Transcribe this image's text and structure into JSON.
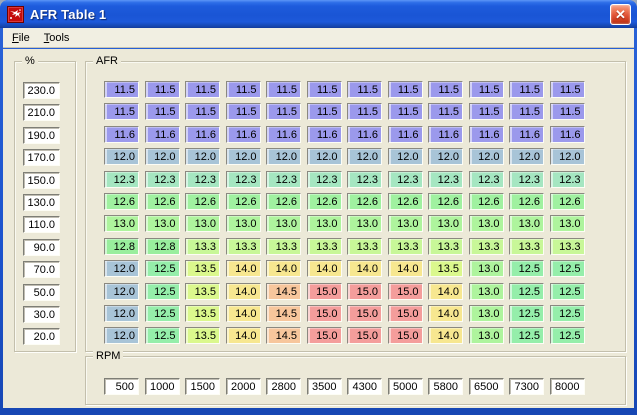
{
  "window": {
    "title": "AFR Table 1"
  },
  "titlebar": {
    "close_glyph": "✕"
  },
  "menu": {
    "items": [
      {
        "label": "File",
        "underline_index": 0
      },
      {
        "label": "Tools",
        "underline_index": 0
      }
    ]
  },
  "load_axis": {
    "label": "%",
    "values": [
      "230.0",
      "210.0",
      "190.0",
      "170.0",
      "150.0",
      "130.0",
      "110.0",
      "90.0",
      "70.0",
      "50.0",
      "30.0",
      "20.0"
    ]
  },
  "rpm_axis": {
    "label": "RPM",
    "values": [
      "500",
      "1000",
      "1500",
      "2000",
      "2800",
      "3500",
      "4300",
      "5000",
      "5800",
      "6500",
      "7300",
      "8000"
    ]
  },
  "afr_table": {
    "label": "AFR",
    "rows": [
      [
        "11.5",
        "11.5",
        "11.5",
        "11.5",
        "11.5",
        "11.5",
        "11.5",
        "11.5",
        "11.5",
        "11.5",
        "11.5",
        "11.5"
      ],
      [
        "11.5",
        "11.5",
        "11.5",
        "11.5",
        "11.5",
        "11.5",
        "11.5",
        "11.5",
        "11.5",
        "11.5",
        "11.5",
        "11.5"
      ],
      [
        "11.6",
        "11.6",
        "11.6",
        "11.6",
        "11.6",
        "11.6",
        "11.6",
        "11.6",
        "11.6",
        "11.6",
        "11.6",
        "11.6"
      ],
      [
        "12.0",
        "12.0",
        "12.0",
        "12.0",
        "12.0",
        "12.0",
        "12.0",
        "12.0",
        "12.0",
        "12.0",
        "12.0",
        "12.0"
      ],
      [
        "12.3",
        "12.3",
        "12.3",
        "12.3",
        "12.3",
        "12.3",
        "12.3",
        "12.3",
        "12.3",
        "12.3",
        "12.3",
        "12.3"
      ],
      [
        "12.6",
        "12.6",
        "12.6",
        "12.6",
        "12.6",
        "12.6",
        "12.6",
        "12.6",
        "12.6",
        "12.6",
        "12.6",
        "12.6"
      ],
      [
        "13.0",
        "13.0",
        "13.0",
        "13.0",
        "13.0",
        "13.0",
        "13.0",
        "13.0",
        "13.0",
        "13.0",
        "13.0",
        "13.0"
      ],
      [
        "12.8",
        "12.8",
        "13.3",
        "13.3",
        "13.3",
        "13.3",
        "13.3",
        "13.3",
        "13.3",
        "13.3",
        "13.3",
        "13.3"
      ],
      [
        "12.0",
        "12.5",
        "13.5",
        "14.0",
        "14.0",
        "14.0",
        "14.0",
        "14.0",
        "13.5",
        "13.0",
        "12.5",
        "12.5"
      ],
      [
        "12.0",
        "12.5",
        "13.5",
        "14.0",
        "14.5",
        "15.0",
        "15.0",
        "15.0",
        "14.0",
        "13.0",
        "12.5",
        "12.5"
      ],
      [
        "12.0",
        "12.5",
        "13.5",
        "14.0",
        "14.5",
        "15.0",
        "15.0",
        "15.0",
        "14.0",
        "13.0",
        "12.5",
        "12.5"
      ],
      [
        "12.0",
        "12.5",
        "13.5",
        "14.0",
        "14.5",
        "15.0",
        "15.0",
        "15.0",
        "14.0",
        "13.0",
        "12.5",
        "12.5"
      ]
    ]
  },
  "value_colors": {
    "11.5": "#9b99ec",
    "11.6": "#9b99ec",
    "12.0": "#a8c4d7",
    "12.3": "#a5e6c1",
    "12.5": "#95eeaa",
    "12.6": "#a0f1a0",
    "12.8": "#99ee9d",
    "13.0": "#aef49d",
    "13.3": "#c8f798",
    "13.5": "#dbf88d",
    "14.0": "#f7e790",
    "14.5": "#f7c69c",
    "15.0": "#f49d9b"
  }
}
